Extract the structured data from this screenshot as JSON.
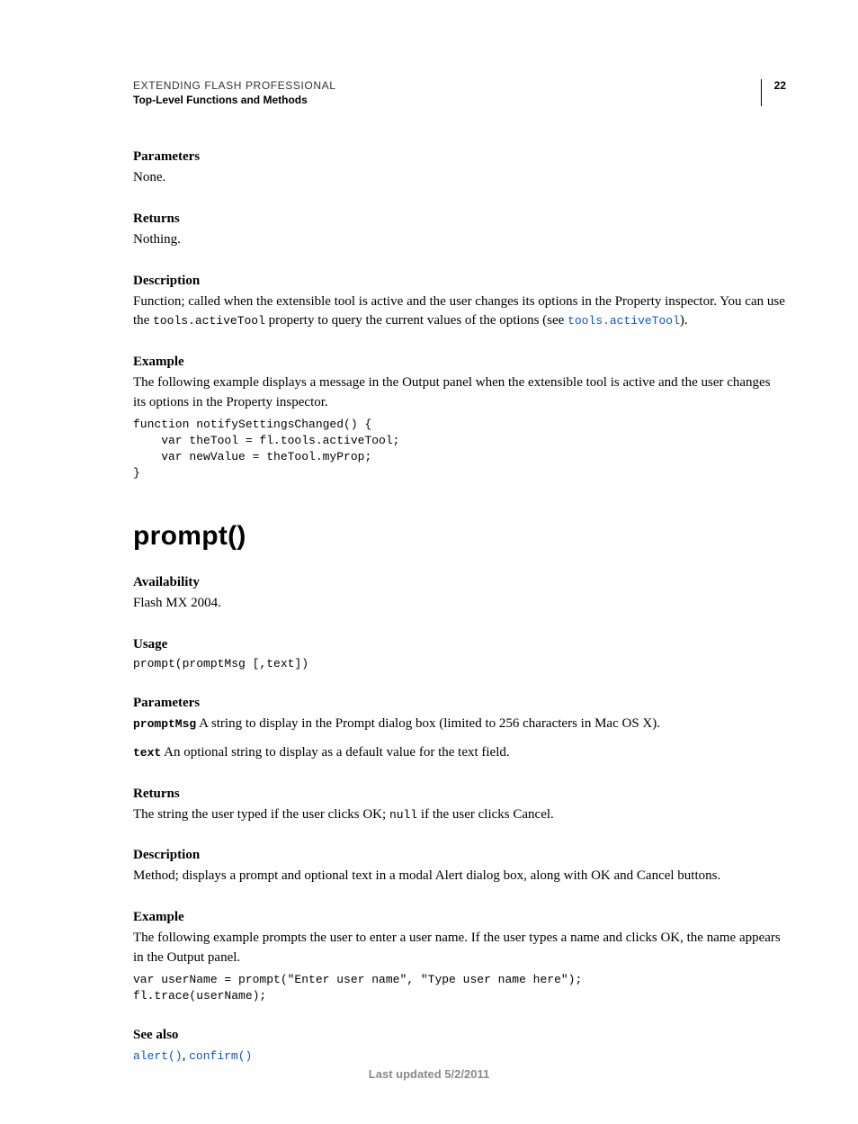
{
  "header": {
    "doc_title": "EXTENDING FLASH PROFESSIONAL",
    "doc_subtitle": "Top-Level Functions and Methods",
    "page_number": "22"
  },
  "sections": {
    "parameters1_h": "Parameters",
    "parameters1_body": "None.",
    "returns1_h": "Returns",
    "returns1_body": "Nothing.",
    "description1_h": "Description",
    "description1_pre": "Function; called when the extensible tool is active and the user changes its options in the Property inspector. You can use the ",
    "description1_code": "tools.activeTool",
    "description1_mid": " property to query the current values of the options (see ",
    "description1_link": "tools.activeTool",
    "description1_post": ").",
    "example1_h": "Example",
    "example1_body": "The following example displays a message in the Output panel when the extensible tool is active and the user changes its options in the Property inspector.",
    "example1_code": "function notifySettingsChanged() {\n    var theTool = fl.tools.activeTool;\n    var newValue = theTool.myProp;\n}",
    "func_title": "prompt()",
    "availability_h": "Availability",
    "availability_body": "Flash MX 2004.",
    "usage_h": "Usage",
    "usage_code": "prompt(promptMsg [,text])",
    "parameters2_h": "Parameters",
    "param_promptMsg_name": "promptMsg",
    "param_promptMsg_desc": "  A string to display in the Prompt dialog box (limited to 256 characters in Mac OS X).",
    "param_text_name": "text",
    "param_text_desc": "  An optional string to display as a default value for the text field.",
    "returns2_h": "Returns",
    "returns2_pre": "The string the user typed if the user clicks OK; ",
    "returns2_code": "null",
    "returns2_post": " if the user clicks Cancel.",
    "description2_h": "Description",
    "description2_body": "Method; displays a prompt and optional text in a modal Alert dialog box, along with OK and Cancel buttons.",
    "example2_h": "Example",
    "example2_body": "The following example prompts the user to enter a user name. If the user types a name and clicks OK, the name appears in the Output panel.",
    "example2_code": "var userName = prompt(\"Enter user name\", \"Type user name here\");\nfl.trace(userName);",
    "seealso_h": "See also",
    "seealso_link1": "alert()",
    "seealso_sep": ", ",
    "seealso_link2": "confirm()"
  },
  "footer": {
    "last_updated": "Last updated 5/2/2011"
  }
}
